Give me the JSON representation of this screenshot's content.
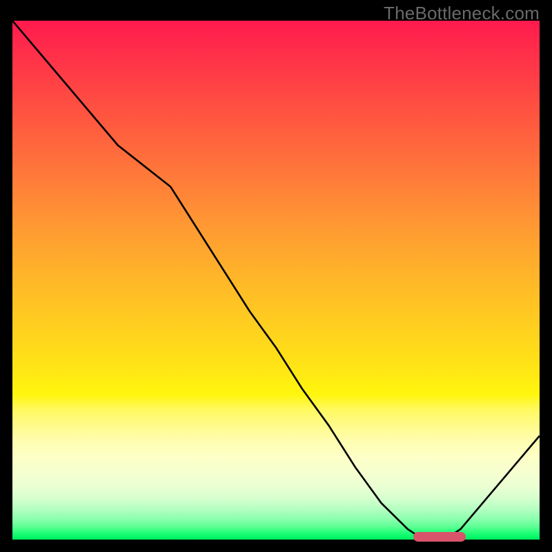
{
  "watermark": "TheBottleneck.com",
  "chart_data": {
    "type": "line",
    "title": "",
    "xlabel": "",
    "ylabel": "",
    "xlim": [
      0,
      100
    ],
    "ylim": [
      0,
      100
    ],
    "grid": false,
    "legend": false,
    "background": {
      "kind": "vertical-heat-gradient",
      "stops": [
        {
          "pct": 0,
          "color": "#ff1a4d"
        },
        {
          "pct": 50,
          "color": "#ffb728"
        },
        {
          "pct": 75,
          "color": "#fff960"
        },
        {
          "pct": 95,
          "color": "#8cffae"
        },
        {
          "pct": 100,
          "color": "#00e85a"
        }
      ]
    },
    "series": [
      {
        "name": "bottleneck-curve",
        "color": "#000000",
        "x": [
          0,
          5,
          10,
          15,
          20,
          25,
          30,
          35,
          40,
          45,
          50,
          55,
          60,
          65,
          70,
          75,
          78,
          82,
          85,
          90,
          95,
          100
        ],
        "y": [
          100,
          94,
          88,
          82,
          76,
          72,
          68,
          60,
          52,
          44,
          37,
          29,
          22,
          14,
          7,
          2,
          0,
          0,
          2,
          8,
          14,
          20
        ]
      }
    ],
    "annotations": [
      {
        "name": "optimal-range-marker",
        "type": "bar-segment",
        "x_start": 76,
        "x_end": 86,
        "y": 0.5,
        "color": "#d9546a"
      }
    ]
  },
  "colors": {
    "curve": "#000000",
    "marker": "#d9546a",
    "frame": "#000000",
    "watermark": "#6a6a6a"
  }
}
